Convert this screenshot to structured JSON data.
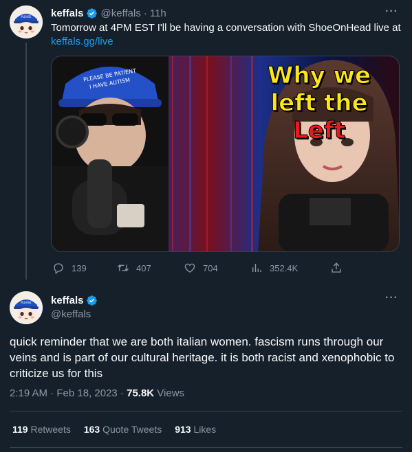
{
  "tweet1": {
    "display_name": "keffals",
    "handle": "@keffals",
    "separator": "·",
    "time": "11h",
    "more": "···",
    "text_before_link": "Tomorrow at 4PM EST I'll be having a conversation with ShoeOnHead live at ",
    "link": "keffals.gg/live",
    "media": {
      "title_line1": "Why we",
      "title_line2": "left the",
      "title_line3": "Left",
      "hat_text_line1": "PLEASE BE PATIENT",
      "hat_text_line2": "I HAVE AUTISM"
    },
    "actions": {
      "replies": "139",
      "retweets": "407",
      "likes": "704",
      "views": "352.4K"
    }
  },
  "tweet2": {
    "display_name": "keffals",
    "handle": "@keffals",
    "more": "···",
    "text": "quick reminder that we are both italian women. fascism runs through our veins and is part of our cultural heritage. it is both racist and xenophobic to criticize us for this",
    "timestamp": "2:19 AM · Feb 18, 2023 · ",
    "views_count": "75.8K",
    "views_label": " Views",
    "retweets_count": "119",
    "retweets_label": " Retweets",
    "quotes_count": "163",
    "quotes_label": " Quote Tweets",
    "likes_count": "913",
    "likes_label": " Likes"
  },
  "colors": {
    "background": "#15202b",
    "accent": "#1d9bf0",
    "muted": "#8b98a5",
    "divider": "#38444d",
    "title_yellow": "#ffe614",
    "title_red": "#ee1a1a"
  }
}
